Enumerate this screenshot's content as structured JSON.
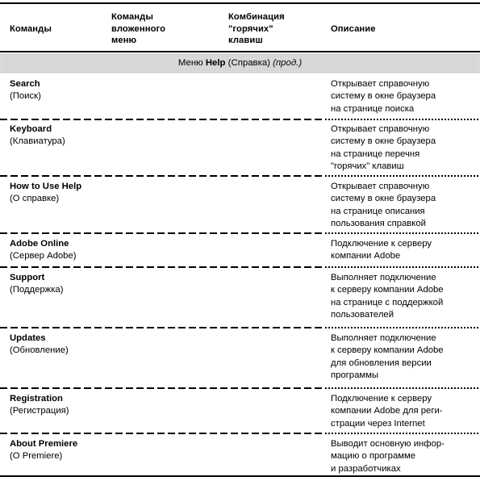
{
  "table": {
    "columns": [
      {
        "id": "commands",
        "lines": [
          "Команды"
        ]
      },
      {
        "id": "submenu",
        "lines": [
          "Команды",
          "вложенного",
          "меню"
        ]
      },
      {
        "id": "hotkeys",
        "lines": [
          "Комбинация",
          "\"горячих\"",
          "клавиш"
        ]
      },
      {
        "id": "description",
        "lines": [
          "Описание"
        ]
      }
    ],
    "section_band": {
      "prefix": "Меню ",
      "menu_name": "Help",
      "translation": " (Справка) ",
      "continued": "(прод.)"
    },
    "rows": [
      {
        "command_en": "Search",
        "command_ru": "(Поиск)",
        "submenu": "",
        "hotkey": "",
        "description": [
          "Открывает справочную",
          "систему в окне браузера",
          "на странице поиска"
        ]
      },
      {
        "command_en": "Keyboard",
        "command_ru": "(Клавиатура)",
        "submenu": "",
        "hotkey": "",
        "description": [
          "Открывает справочную",
          "систему в окне браузера",
          "на странице перечня",
          "\"горячих\" клавиш"
        ]
      },
      {
        "command_en": "How to Use Help",
        "command_ru": "(О справке)",
        "submenu": "",
        "hotkey": "",
        "description": [
          "Открывает справочную",
          "систему в окне браузера",
          "на странице описания",
          "пользования справкой"
        ]
      },
      {
        "command_en": "Adobe Online",
        "command_ru": "(Сервер Adobe)",
        "submenu": "",
        "hotkey": "",
        "description": [
          "Подключение к серверу",
          "компании Adobe"
        ]
      },
      {
        "command_en": "Support",
        "command_ru": "(Поддержка)",
        "submenu": "",
        "hotkey": "",
        "description": [
          "Выполняет подключение",
          "к серверу компании Adobe",
          "на странице с поддержкой",
          "пользователей"
        ]
      },
      {
        "command_en": "Updates",
        "command_ru": "(Обновление)",
        "submenu": "",
        "hotkey": "",
        "description": [
          "Выполняет подключение",
          "к серверу компании Adobe",
          "для обновления версии",
          "программы"
        ]
      },
      {
        "command_en": "Registration",
        "command_ru": "(Регистрация)",
        "submenu": "",
        "hotkey": "",
        "description": [
          "Подключение к серверу",
          "компании Adobe для реги-",
          "страции через Internet"
        ]
      },
      {
        "command_en": "About Premiere",
        "command_ru": "(O Premiere)",
        "submenu": "",
        "hotkey": "",
        "description": [
          "Выводит основную инфор-",
          "мацию о программе",
          "и разработчиках"
        ]
      }
    ]
  },
  "style": {
    "band_background": "#c9c9c9",
    "text_color": "#000000",
    "page_background": "#ffffff"
  }
}
